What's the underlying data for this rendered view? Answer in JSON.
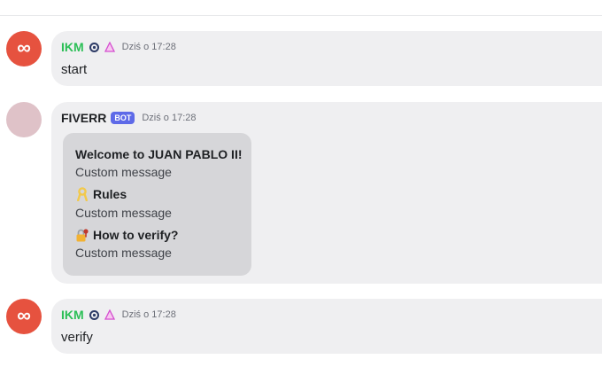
{
  "messages": [
    {
      "author": "IKM",
      "timestamp": "Dziś o 17:28",
      "text": "start"
    },
    {
      "author": "FIVERR",
      "badge": "BOT",
      "timestamp": "Dziś o 17:28",
      "embed": {
        "welcome_title": "Welcome to JUAN PABLO II!",
        "welcome_desc": "Custom message",
        "rules_title": "Rules",
        "rules_desc": "Custom message",
        "verify_title": "How to verify?",
        "verify_desc": "Custom message"
      }
    },
    {
      "author": "IKM",
      "timestamp": "Dziś o 17:28",
      "text": "verify"
    }
  ],
  "colors": {
    "ikm_name": "#2bbf56",
    "bot_badge": "#5e6ae8",
    "avatar_red": "#e6523f",
    "avatar_pink": "#dfc2c8"
  },
  "icons": [
    "infinity-icon",
    "headset-badge-icon",
    "triangle-badge-icon",
    "ribbon-icon",
    "locked-key-icon"
  ]
}
